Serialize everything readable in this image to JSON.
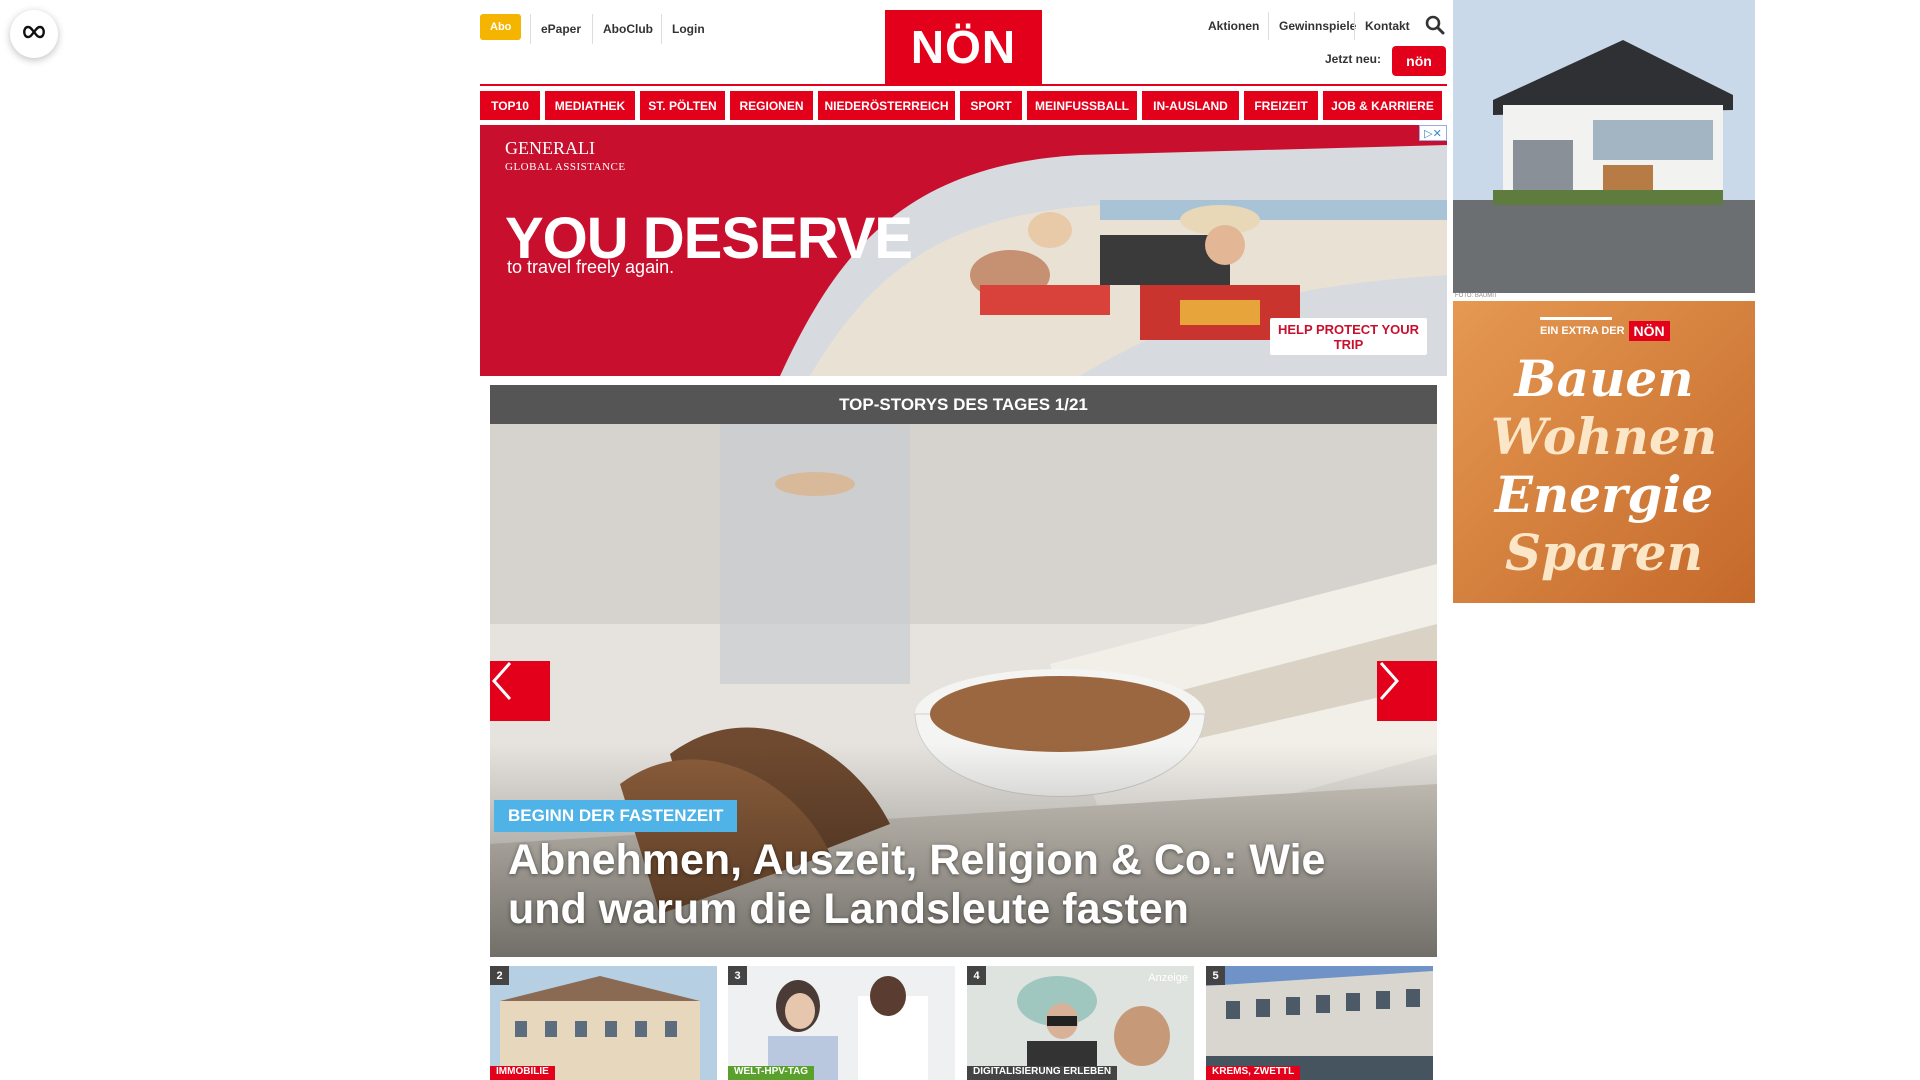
{
  "a11y": {
    "icon": "infinity-icon"
  },
  "header": {
    "abo_label": "Abo",
    "links": [
      "ePaper",
      "AboClub",
      "Login"
    ],
    "logo": "NÖN",
    "right_links": [
      "Aktionen",
      "Gewinnspiele",
      "Kontakt"
    ],
    "search_icon": "search-icon",
    "jetzt_label": "Jetzt neu:",
    "jetzt_logo": "nön"
  },
  "nav": {
    "items": [
      "TOP10",
      "MEDIATHEK",
      "ST. PÖLTEN",
      "REGIONEN",
      "NIEDERÖSTERREICH",
      "SPORT",
      "MEINFUSSBALL",
      "IN-AUSLAND",
      "FREIZEIT",
      "JOB & KARRIERE"
    ]
  },
  "banner": {
    "brand": "GENERALI",
    "brand_sub": "GLOBAL ASSISTANCE",
    "headline": "YOU DESERVE",
    "sub": "to travel freely again.",
    "cta": "HELP PROTECT YOUR TRIP"
  },
  "stories": {
    "header": "TOP-STORYS DES TAGES 1/21",
    "tag": "BEGINN DER FASTENZEIT",
    "title": "Abnehmen, Auszeit, Religion & Co.: Wie und warum die Landsleute fasten"
  },
  "thumbs": [
    {
      "num": "2",
      "cat": "IMMOBILIE",
      "cat_color": "#e2001a"
    },
    {
      "num": "3",
      "cat": "WELT-HPV-TAG",
      "cat_color": "#5aa02c"
    },
    {
      "num": "4",
      "cat": "DIGITALISIERUNG ERLEBEN",
      "cat_color": "#444444",
      "anzeige": "Anzeige"
    },
    {
      "num": "5",
      "cat": "KREMS, ZWETTL",
      "cat_color": "#e2001a"
    }
  ],
  "rail": {
    "credit": "FOTO: BAUMIT",
    "extra": "EIN EXTRA DER",
    "extra_logo": "NÖN",
    "words": [
      "Bauen",
      "Wohnen",
      "Energie",
      "Sparen"
    ]
  },
  "colors": {
    "brand_red": "#e2001a",
    "abo_yellow": "#f5b400",
    "tag_blue": "#4fb3e8",
    "dark_header": "#555555"
  }
}
